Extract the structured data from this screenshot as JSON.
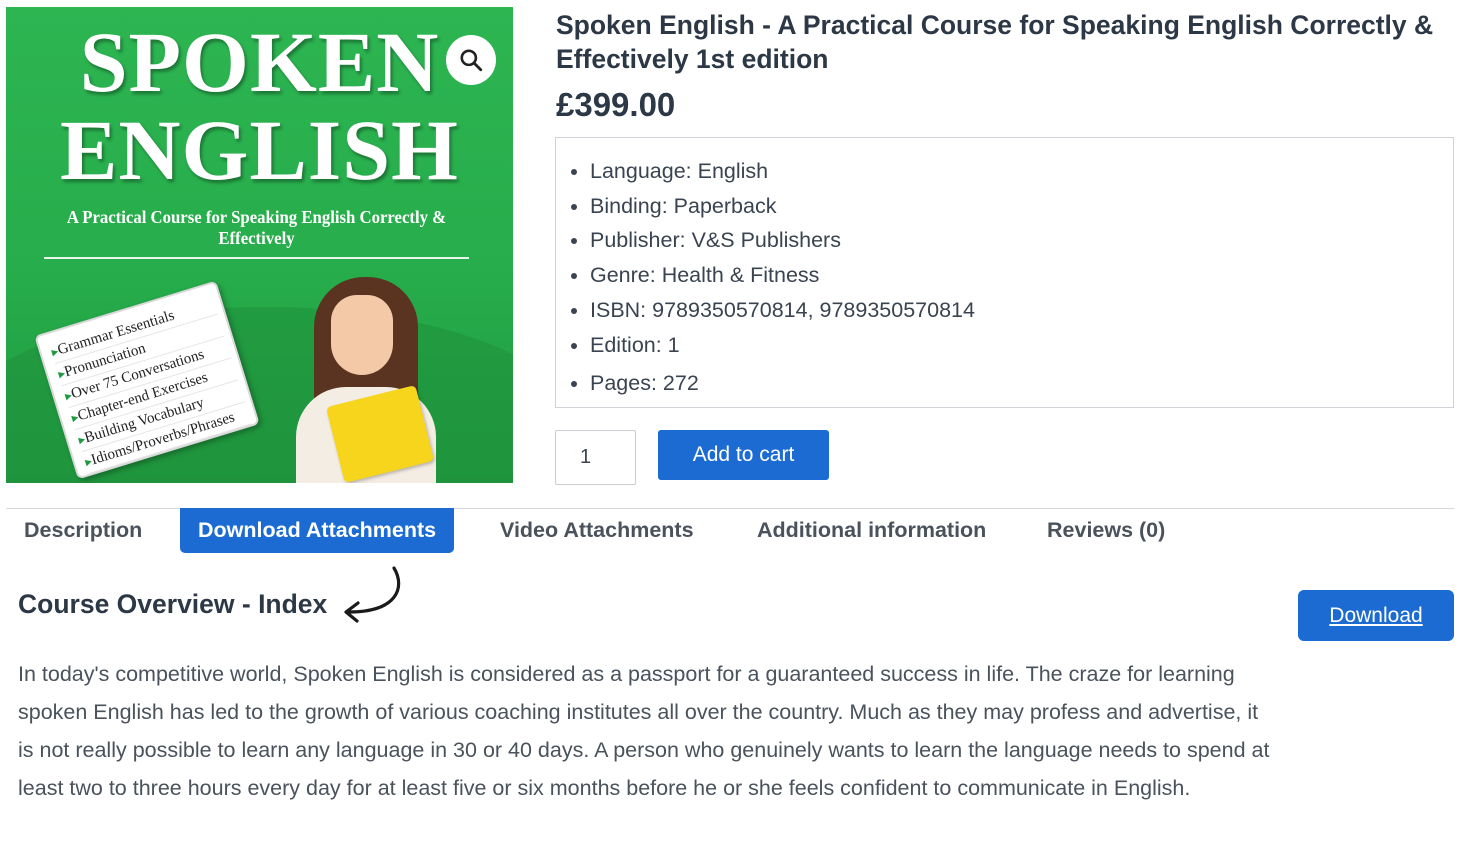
{
  "product_image": {
    "title_line1": "SPOKEN",
    "title_line2": "ENGLISH",
    "subtitle": "A Practical Course for Speaking English Correctly & Effectively",
    "checklist": [
      "Grammar Essentials",
      "Pronunciation",
      "Over 75 Conversations",
      "Chapter-end Exercises",
      "Building Vocabulary",
      "Idioms/Proverbs/Phrases"
    ],
    "zoom_icon": "search-icon",
    "colors": {
      "cover_green": "#2db552"
    }
  },
  "product": {
    "title": "Spoken English - A Practical Course for Speaking English Correctly & Effectively 1st edition",
    "price": "£399.00",
    "meta": [
      "Language: English",
      "Binding: Paperback",
      "Publisher: V&S Publishers",
      "Genre: Health & Fitness",
      "ISBN: 9789350570814, 9789350570814",
      "Edition: 1",
      "Pages: 272"
    ],
    "quantity": "1",
    "add_to_cart_label": "Add to cart"
  },
  "tabs": [
    {
      "label": "Description",
      "active": false
    },
    {
      "label": "Download Attachments",
      "active": true
    },
    {
      "label": "Video Attachments",
      "active": false
    },
    {
      "label": "Additional information",
      "active": false
    },
    {
      "label": "Reviews (0)",
      "active": false
    }
  ],
  "panel": {
    "heading": "Course Overview - Index",
    "download_label": "Download",
    "description": "In today's competitive world, Spoken English is considered as a passport for a guaranteed success in life. The craze for learning spoken English has led to the growth of various coaching institutes all over the country. Much as they may profess and advertise, it is not really possible to learn any language in 30 or 40 days. A person who genuinely wants to learn the language needs to spend at least two to three hours every day for at least five or six months before he or she feels confident to communicate in English."
  },
  "colors": {
    "accent": "#1b6bd2",
    "text": "#2c3845",
    "muted_text": "#4a525c",
    "border": "#cfd3d8"
  }
}
